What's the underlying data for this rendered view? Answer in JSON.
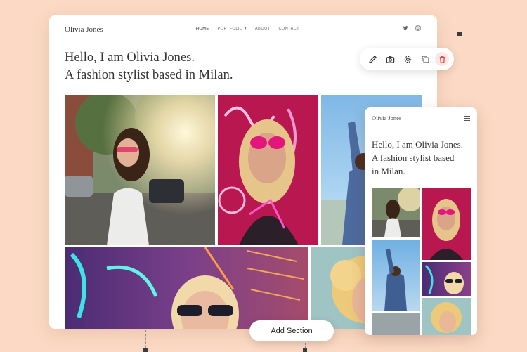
{
  "desktop": {
    "logo": "Olivia Jones",
    "nav": [
      "HOME",
      "PORTFOLIO ▾",
      "ABOUT",
      "CONTACT"
    ],
    "hero_line1": "Hello, I am Olivia Jones.",
    "hero_line2": "A fashion stylist based in Milan."
  },
  "mobile": {
    "logo": "Olivia Jones",
    "hero_line1": "Hello, I am Olivia Jones.",
    "hero_line2": "A fashion stylist based",
    "hero_line3": "in Milan."
  },
  "toolbar": {
    "icons": [
      "pencil-icon",
      "camera-icon",
      "gear-icon",
      "duplicate-icon",
      "trash-icon"
    ]
  },
  "add_section_label": "Add Section",
  "colors": {
    "background": "#fbd9c4",
    "card": "#ffffff",
    "delete": "#e53935"
  }
}
